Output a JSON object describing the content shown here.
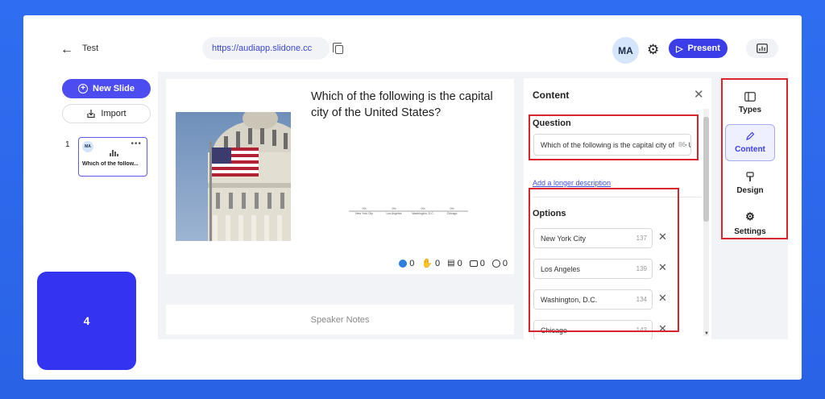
{
  "header": {
    "doc_title": "Test",
    "url": "https://audiapp.slidone.cc",
    "avatar_initials": "MA",
    "present_label": "Present"
  },
  "sidebar": {
    "new_slide_label": "New Slide",
    "import_label": "Import",
    "slides": [
      {
        "number": "1",
        "avatar": "MA",
        "title": "Which of the follow..."
      }
    ]
  },
  "counter_tile": {
    "value": "4"
  },
  "slide": {
    "question": "Which of the following is the capital city of the United States?",
    "image": "us-capitol-with-flag",
    "mini_chart": {
      "labels": [
        "New York City",
        "Los Angeles",
        "Washington, D.C.",
        "Chicago"
      ],
      "percents": [
        "0%",
        "0%",
        "0%",
        "0%"
      ]
    },
    "stats": [
      {
        "icon": "like-icon",
        "value": "0"
      },
      {
        "icon": "hand-icon",
        "value": "0"
      },
      {
        "icon": "qa-icon",
        "value": "0"
      },
      {
        "icon": "comment-icon",
        "value": "0"
      },
      {
        "icon": "user-icon",
        "value": "0"
      }
    ]
  },
  "speaker_notes": {
    "label": "Speaker Notes"
  },
  "content_panel": {
    "title": "Content",
    "question_label": "Question",
    "question_value": "Which of the following is the capital city of the United States?",
    "question_remaining": "86",
    "longer_description_link": "Add a longer description",
    "options_label": "Options",
    "options": [
      {
        "value": "New York City",
        "remaining": "137"
      },
      {
        "value": "Los Angeles",
        "remaining": "139"
      },
      {
        "value": "Washington, D.C.",
        "remaining": "134"
      },
      {
        "value": "Chicago",
        "remaining": "143"
      }
    ]
  },
  "toolbar": {
    "types_label": "Types",
    "content_label": "Content",
    "design_label": "Design",
    "settings_label": "Settings"
  },
  "colors": {
    "accent": "#3b3ee8",
    "highlight": "#d9252c",
    "background": "#2f6ef0"
  }
}
